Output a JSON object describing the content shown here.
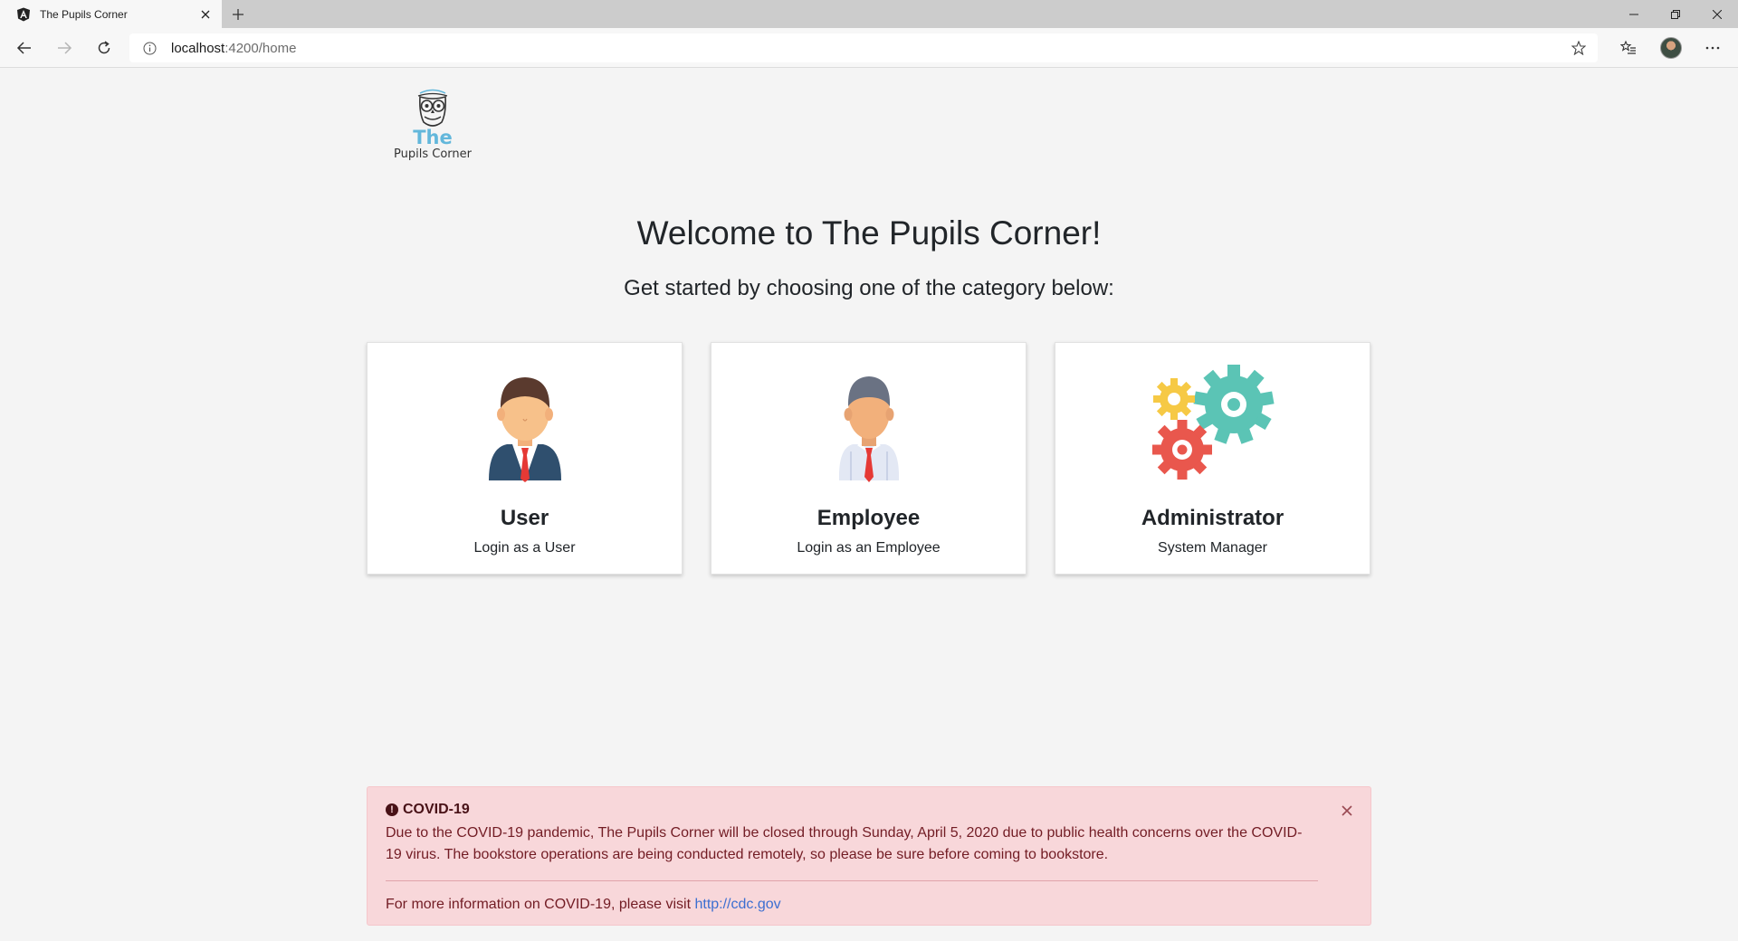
{
  "browser": {
    "tab_title": "The Pupils Corner",
    "url_host": "localhost",
    "url_path": ":4200/home"
  },
  "logo": {
    "title": "The",
    "subtitle": "Pupils Corner"
  },
  "main": {
    "heading": "Welcome to The Pupils Corner!",
    "subheading": "Get started by choosing one of the category below:"
  },
  "cards": [
    {
      "icon": "businessman-icon",
      "title": "User",
      "text": "Login as a User"
    },
    {
      "icon": "employee-icon",
      "title": "Employee",
      "text": "Login as an Employee"
    },
    {
      "icon": "gears-icon",
      "title": "Administrator",
      "text": "System Manager"
    }
  ],
  "alert": {
    "heading": "COVID-19",
    "body": "Due to the COVID-19 pandemic, The Pupils Corner will be closed through Sunday, April 5, 2020 due to public health concerns over the COVID-19 virus. The bookstore operations are being conducted remotely, so please be sure before coming to bookstore.",
    "footer_text": "For more information on COVID-19, please visit ",
    "link_text": "http://cdc.gov"
  },
  "colors": {
    "alert_bg": "#f8d7da",
    "alert_text": "#721c24",
    "logo_accent": "#62b7db",
    "gear_teal": "#5bc4b5",
    "gear_yellow": "#f6c945",
    "gear_red": "#e9574d"
  }
}
